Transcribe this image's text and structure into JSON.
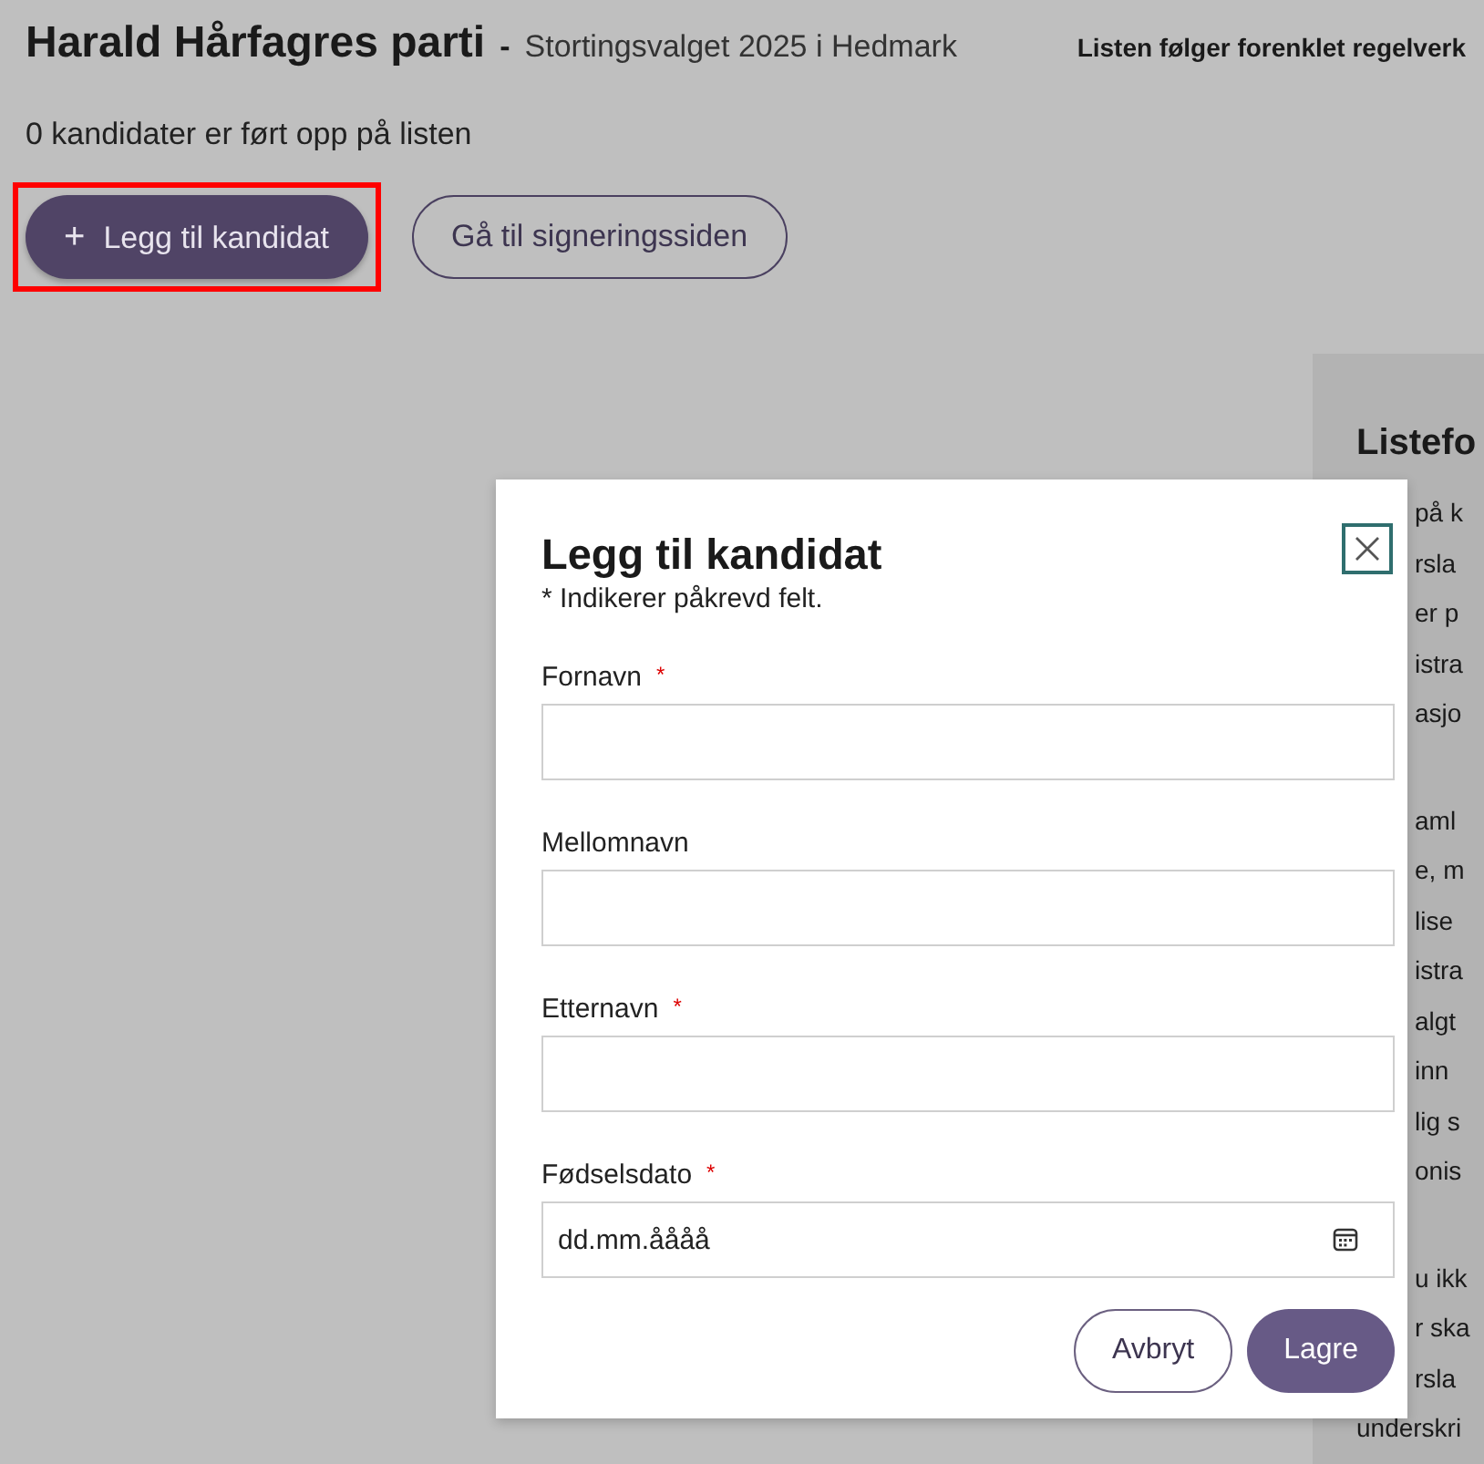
{
  "page": {
    "title": "Harald Hårfagres parti",
    "separator": "-",
    "subtitle": "Stortingsvalget 2025 i Hedmark",
    "rule_note": "Listen følger forenklet regelverk",
    "candidate_count": "0 kandidater er ført opp på listen",
    "buttons": [
      {
        "icon": "+",
        "label": "Legg til kandidat",
        "kind": "primary",
        "highlighted": true
      },
      {
        "label": "Gå til signeringssiden",
        "kind": "secondary",
        "highlighted": false
      }
    ]
  },
  "side_panel": {
    "heading": "Listefo",
    "paragraphs": [
      [
        {
          "text": "på k",
          "partly_hidden": true
        },
        {
          "text": "rsla",
          "partly_hidden": true
        },
        {
          "text": "er p",
          "partly_hidden": true
        },
        {
          "text": "istra",
          "partly_hidden": true
        },
        {
          "text": "asjo",
          "partly_hidden": true
        }
      ],
      [
        {
          "text": "aml",
          "partly_hidden": true
        },
        {
          "text": "e, m",
          "partly_hidden": true
        },
        {
          "text": "lise",
          "partly_hidden": true
        },
        {
          "text": "istra",
          "partly_hidden": true
        },
        {
          "text": "algt",
          "partly_hidden": true
        },
        {
          "text": "inn",
          "partly_hidden": true
        },
        {
          "text": "lig s",
          "partly_hidden": true
        },
        {
          "text": "onis",
          "partly_hidden": true
        }
      ],
      [
        {
          "text": "u ikk",
          "partly_hidden": true
        },
        {
          "text": "r ska",
          "partly_hidden": true
        },
        {
          "text": "rsla",
          "partly_hidden": true
        },
        {
          "text": "underskri",
          "partly_hidden": false
        }
      ]
    ]
  },
  "dialog": {
    "title": "Legg til kandidat",
    "required_note": "* Indikerer påkrevd felt.",
    "required_mark": "*",
    "fields": [
      {
        "label": "Fornavn",
        "required": true,
        "kind": "text"
      },
      {
        "label": "Mellomnavn",
        "required": false,
        "kind": "text"
      },
      {
        "label": "Etternavn",
        "required": true,
        "kind": "text"
      },
      {
        "label": "Fødselsdato",
        "required": true,
        "kind": "date",
        "placeholder": "dd.mm.åååå"
      }
    ],
    "buttons": [
      {
        "label": "Avbryt",
        "kind": "secondary"
      },
      {
        "label": "Lagre",
        "kind": "primary"
      }
    ]
  }
}
